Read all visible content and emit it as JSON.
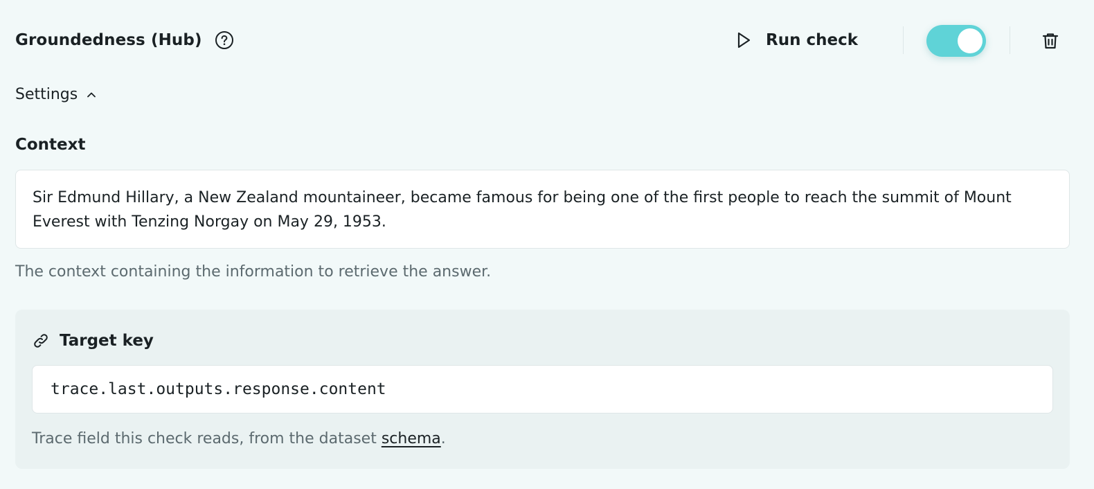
{
  "header": {
    "title": "Groundedness (Hub)",
    "run_check_label": "Run check",
    "enabled": true
  },
  "settings": {
    "label": "Settings",
    "expanded": true
  },
  "context": {
    "label": "Context",
    "value": "Sir Edmund Hillary, a New Zealand mountaineer, became famous for being one of the first people to reach the summit of Mount Everest with Tenzing Norgay on May 29, 1953.",
    "help": "The context containing the information to retrieve the answer."
  },
  "target_key": {
    "label": "Target key",
    "value": "trace.last.outputs.response.content",
    "help_prefix": "Trace field this check reads, from the dataset ",
    "help_link": "schema",
    "help_suffix": "."
  },
  "colors": {
    "accent": "#5fd3d7",
    "background": "#f2f9f9",
    "panel": "#eaf2f2"
  },
  "icons": [
    "help-circle-icon",
    "play-icon",
    "trash-icon",
    "chevron-up-icon",
    "link-icon"
  ]
}
